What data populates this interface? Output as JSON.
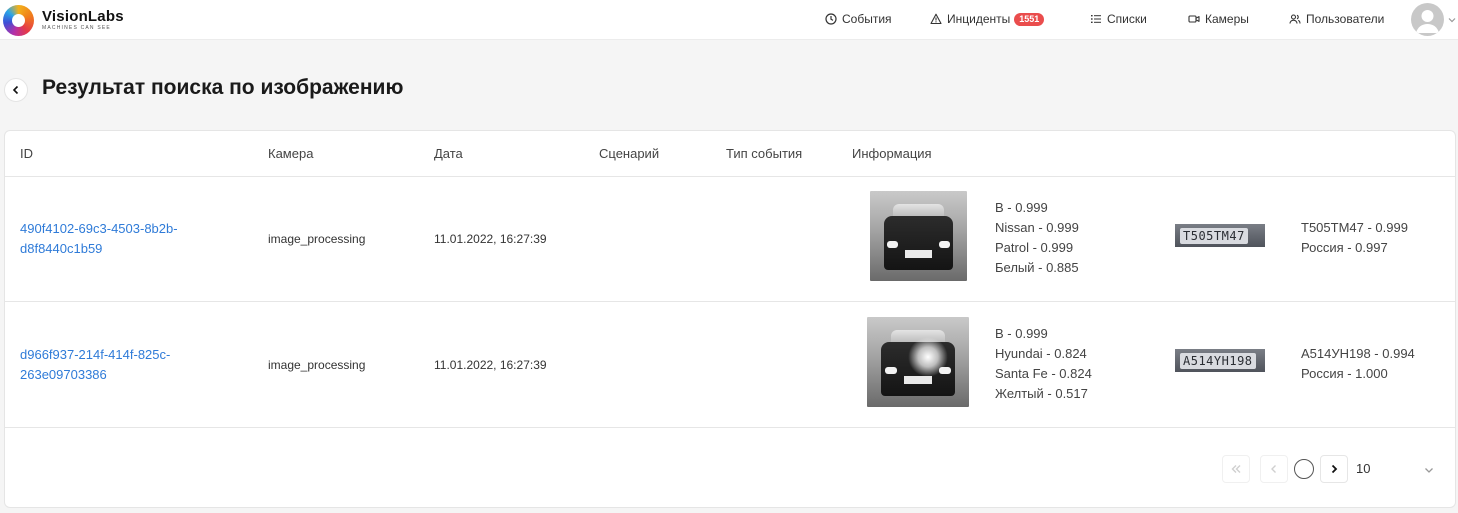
{
  "header": {
    "brand_name": "VisionLabs",
    "brand_tagline": "MACHINES CAN SEE",
    "nav": {
      "events": "События",
      "incidents": "Инциденты",
      "incidents_count": "1551",
      "lists": "Списки",
      "cameras": "Камеры",
      "users": "Пользователи"
    }
  },
  "page": {
    "title": "Результат поиска по изображению"
  },
  "table": {
    "columns": {
      "id": "ID",
      "camera": "Камера",
      "date": "Дата",
      "scenario": "Сценарий",
      "event_type": "Тип события",
      "info": "Информация"
    },
    "rows": [
      {
        "id_line1": "490f4102-69c3-4503-8b2b-",
        "id_line2": "d8f8440c1b59",
        "camera": "image_processing",
        "date": "11.01.2022, 16:27:39",
        "scenario": "",
        "event_type": "",
        "vehicle": {
          "category": "B - 0.999",
          "brand": "Nissan - 0.999",
          "model": "Patrol - 0.999",
          "color": "Белый - 0.885"
        },
        "plate_image_text": "T505TM47",
        "plate": {
          "number": "T505TM47 - 0.999",
          "country": "Россия - 0.997"
        }
      },
      {
        "id_line1": "d966f937-214f-414f-825c-",
        "id_line2": "263e09703386",
        "camera": "image_processing",
        "date": "11.01.2022, 16:27:39",
        "scenario": "",
        "event_type": "",
        "vehicle": {
          "category": "B - 0.999",
          "brand": "Hyundai - 0.824",
          "model": "Santa Fe - 0.824",
          "color": "Желтый - 0.517"
        },
        "plate_image_text": "A514YH198",
        "plate": {
          "number": "A514УН198 - 0.994",
          "country": "Россия - 1.000"
        }
      }
    ]
  },
  "pagination": {
    "page_size": "10",
    "icons": [
      "double-chevron-left-icon",
      "chevron-left-icon",
      "chevron-right-icon",
      "chevron-down-icon"
    ]
  },
  "colors": {
    "link": "#2f7bd8",
    "badge": "#ea4d4d",
    "background": "#f5f5f5"
  }
}
